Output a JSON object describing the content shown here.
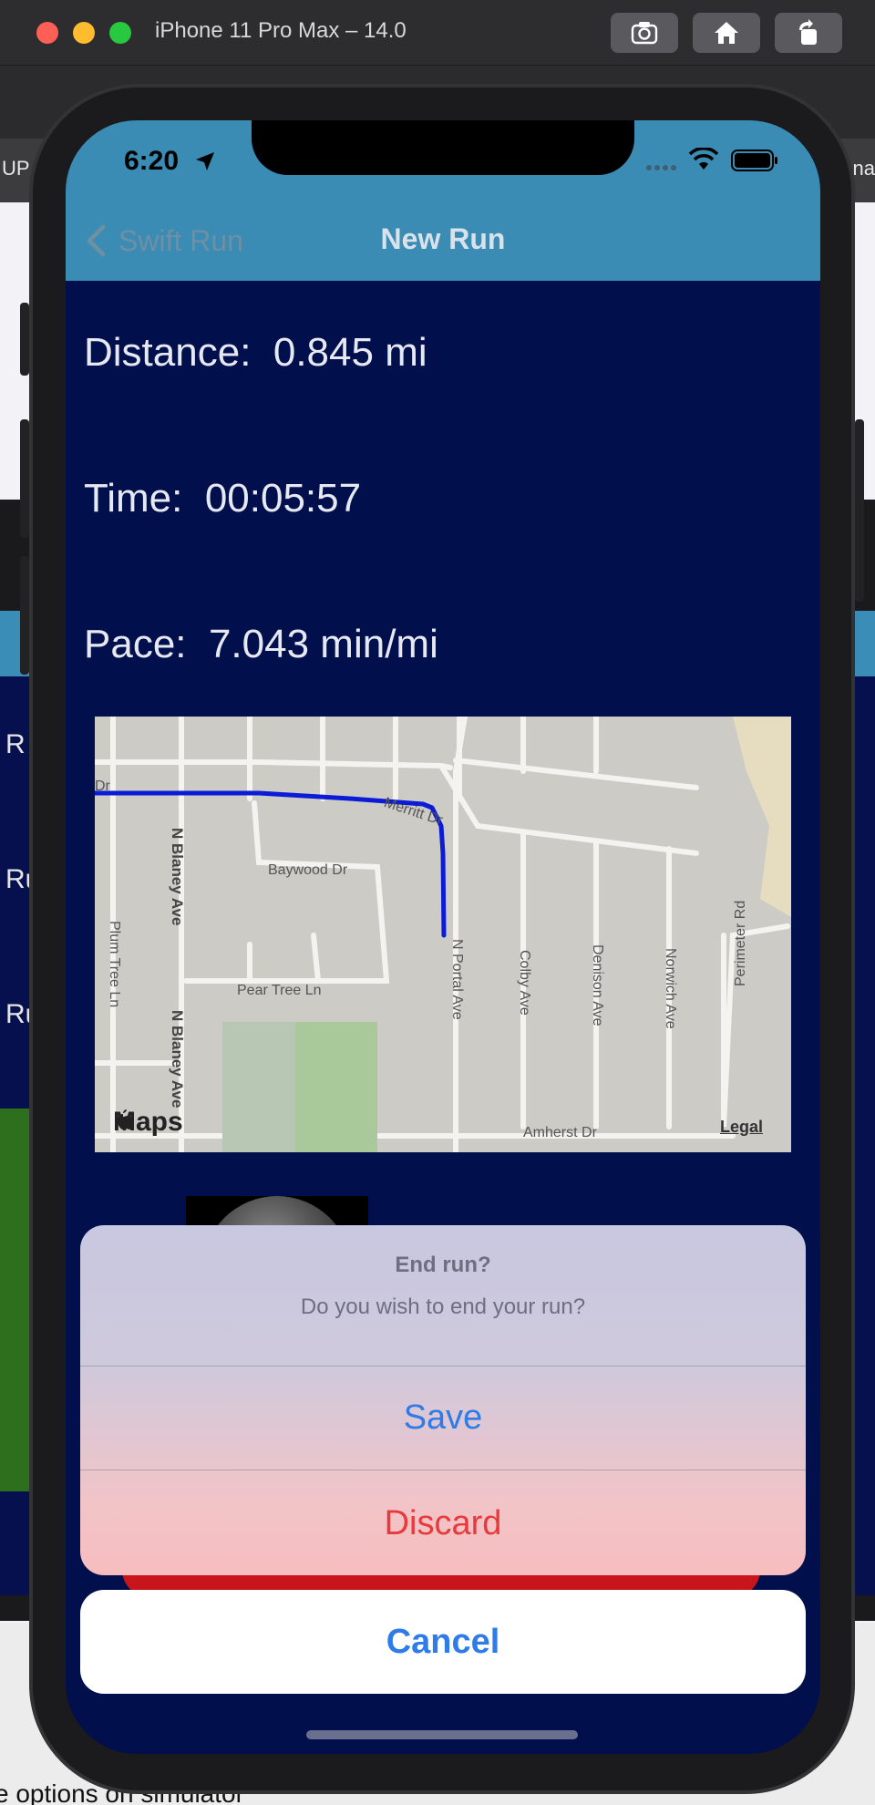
{
  "simulator": {
    "title": "iPhone 11 Pro Max – 14.0",
    "tools": [
      "screenshot-icon",
      "home-icon",
      "rotate-icon"
    ]
  },
  "background": {
    "strip_left": "UP",
    "strip_right": "na",
    "side_texts": [
      "R",
      "Ru",
      "Ru"
    ],
    "caption": "e options on simulator"
  },
  "status_bar": {
    "time": "6:20"
  },
  "nav": {
    "back_label": "Swift Run",
    "title": "New Run"
  },
  "stats": {
    "distance": "Distance:  0.845 mi",
    "time": "Time:  00:05:57",
    "pace": "Pace:  7.043 min/mi"
  },
  "map": {
    "labels": {
      "merritt": "Merritt Dr",
      "dr_left": "Dr",
      "baywood": "Baywood Dr",
      "pear_tree": "Pear Tree Ln",
      "plum_tree": "Plum Tree Ln",
      "n_blaney_1": "N Blaney Ave",
      "n_blaney_2": "N Blaney Ave",
      "n_portal": "N Portal Ave",
      "colby": "Colby Ave",
      "denison": "Denison Ave",
      "norwich": "Norwich Ave",
      "perimeter": "Perimeter Rd",
      "amherst": "Amherst Dr"
    },
    "logo": "Maps",
    "legal": "Legal",
    "route_color": "#0b1bd6"
  },
  "action_sheet": {
    "title": "End run?",
    "message": "Do you wish to end your run?",
    "save": "Save",
    "discard": "Discard",
    "cancel": "Cancel"
  },
  "colors": {
    "nav": "#3a8cb4",
    "screen_bg": "#020f4d",
    "action_blue": "#2f7be8",
    "destructive_red": "#e63a3d"
  }
}
